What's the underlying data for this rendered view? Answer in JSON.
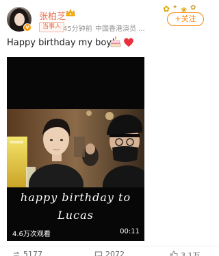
{
  "header": {
    "username": "张柏芝",
    "role_badge": "当事人",
    "time": "45分钟前",
    "source": "中国香港演员 ...",
    "follow_label": "+关注"
  },
  "post": {
    "text": "Happy birthday my boy!"
  },
  "video": {
    "caption_line1": "happy birthday to",
    "caption_line2": "Lucas",
    "views": "4.6万次观看",
    "duration": "00:11"
  },
  "footer": {
    "reposts": "5177",
    "comments": "2072",
    "likes": "3.1万"
  },
  "colors": {
    "username": "#eb7350",
    "follow": "#ff8200",
    "verify": "#ff9a00",
    "heart": "#e8303b"
  },
  "icons": {
    "verify": "verified-v-icon",
    "member": "crown-icon",
    "cake": "cake-emoji-icon",
    "heart": "red-heart-emoji-icon",
    "repost": "repost-icon",
    "comment": "comment-icon",
    "like": "like-icon"
  }
}
